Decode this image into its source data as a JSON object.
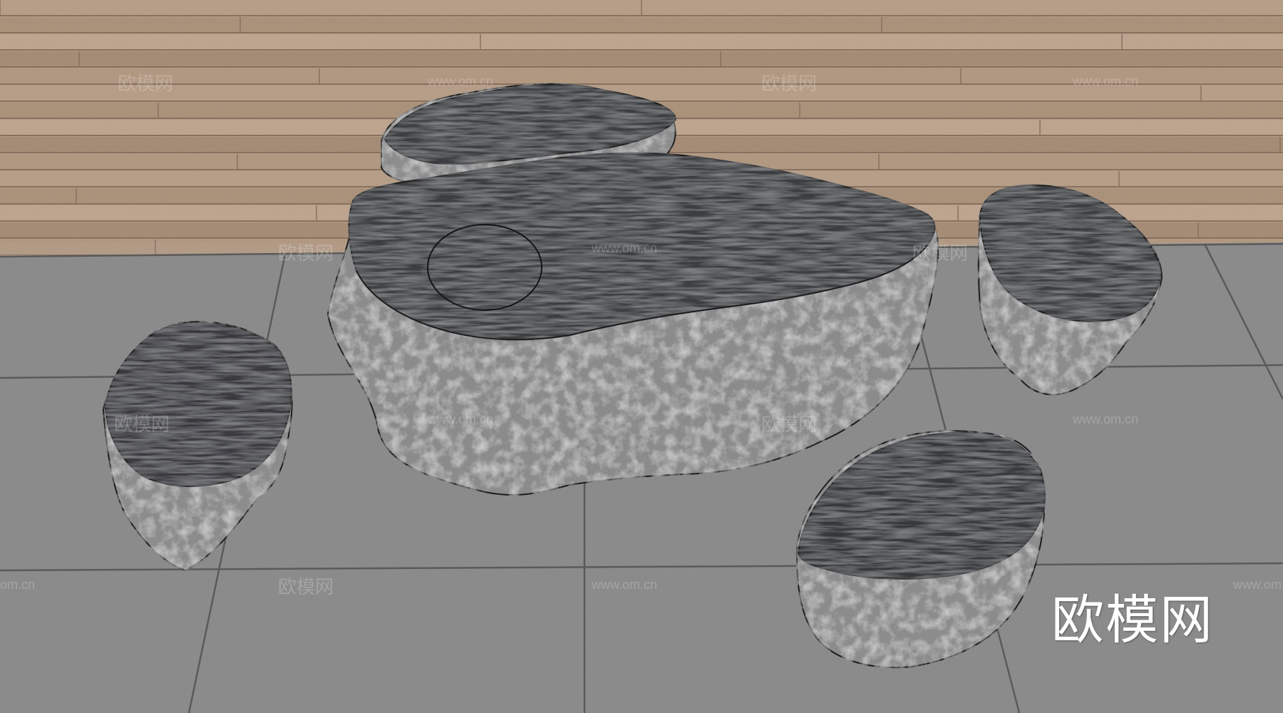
{
  "scene": {
    "colors": {
      "wood_light": "#b8a08a",
      "wood_dark": "#8a7260",
      "tile": "#8f8f8f",
      "tile_grout": "#5e5e5e",
      "stone_side": "#8a8a8a",
      "stone_top": "#3a3c3e",
      "outline": "#1e1e1e"
    },
    "objects": [
      "table-rock",
      "stool-back",
      "stool-left",
      "stool-right",
      "stool-front"
    ]
  },
  "watermark": {
    "brand": "欧模网",
    "url": "www.om.cn",
    "url_partial": "om.cn"
  }
}
